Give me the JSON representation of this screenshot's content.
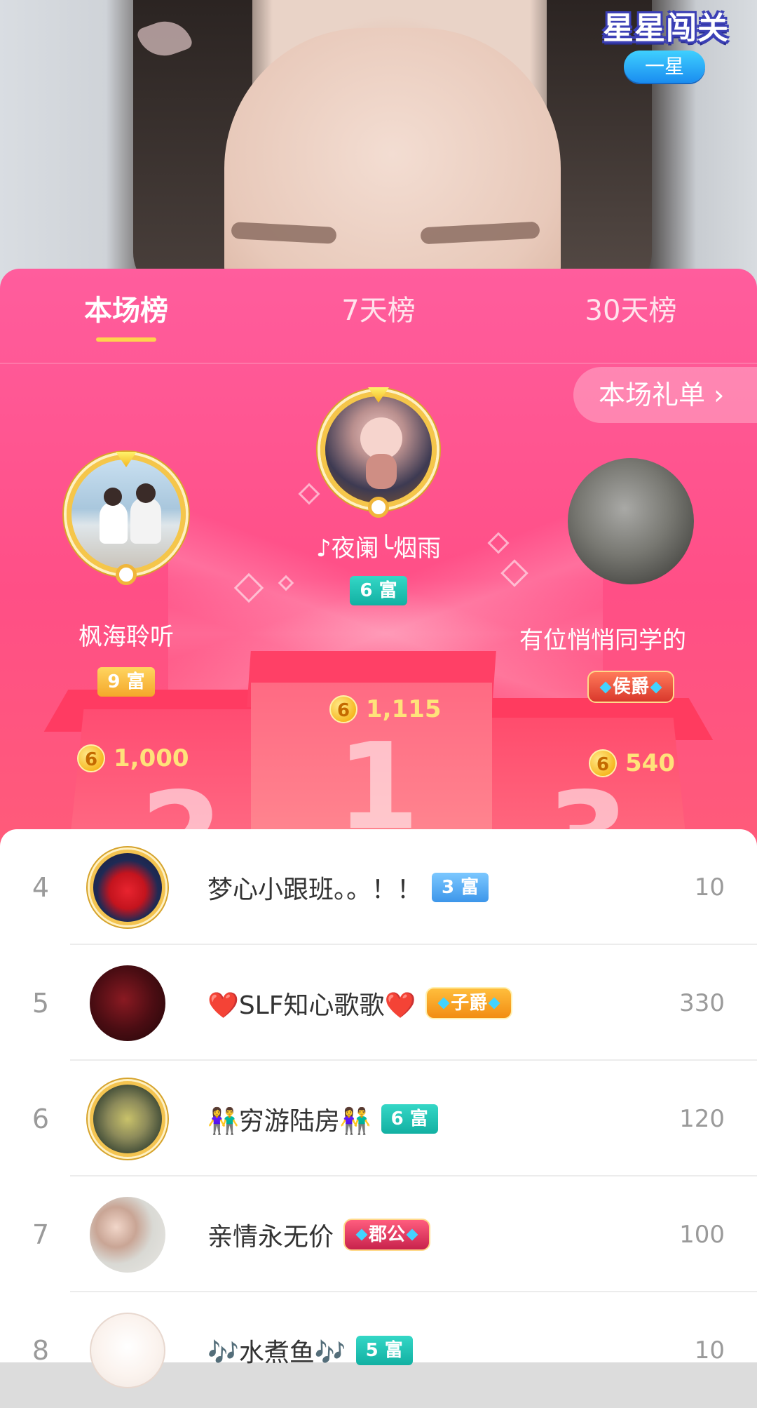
{
  "stream_badge": {
    "title": "星星闯关",
    "level": "一星"
  },
  "tabs": [
    {
      "label": "本场榜",
      "active": true
    },
    {
      "label": "7天榜",
      "active": false
    },
    {
      "label": "30天榜",
      "active": false
    }
  ],
  "gift_list_button": "本场礼单 ›",
  "top3": [
    {
      "rank": 2,
      "name": "枫海聆听",
      "tag": "9 富",
      "tag_style": "gold",
      "score": "1,000"
    },
    {
      "rank": 1,
      "name": "♪夜阑╰烟雨",
      "tag": "6 富",
      "tag_style": "teal",
      "score": "1,115"
    },
    {
      "rank": 3,
      "name": "有位悄悄同学的",
      "tag": "侯爵",
      "tag_style": "noble-red",
      "score": "540"
    }
  ],
  "coin_symbol": "6",
  "podium_numbers": [
    "2",
    "1",
    "3"
  ],
  "list": [
    {
      "rank": "4",
      "name": "梦心小跟班。。！！",
      "tag": "3 富",
      "tag_style": "blue",
      "score": "10"
    },
    {
      "rank": "5",
      "name": "❤️SLF知心歌歌❤️",
      "tag": "子爵",
      "tag_style": "noble-orange",
      "score": "330"
    },
    {
      "rank": "6",
      "name": "👫穷游陆房👫",
      "tag": "6 富",
      "tag_style": "teal",
      "score": "120"
    },
    {
      "rank": "7",
      "name": "亲情永无价",
      "tag": "郡公",
      "tag_style": "noble-magenta",
      "score": "100"
    },
    {
      "rank": "8",
      "name": "🎶水煮鱼🎶",
      "tag": "5 富",
      "tag_style": "teal",
      "score": "10"
    }
  ],
  "colors": {
    "panel_top": "#ff5d9d",
    "panel_bottom": "#ff7a6a",
    "tab_indicator": "#ffd34d",
    "score_gold": "#ffe27a"
  }
}
